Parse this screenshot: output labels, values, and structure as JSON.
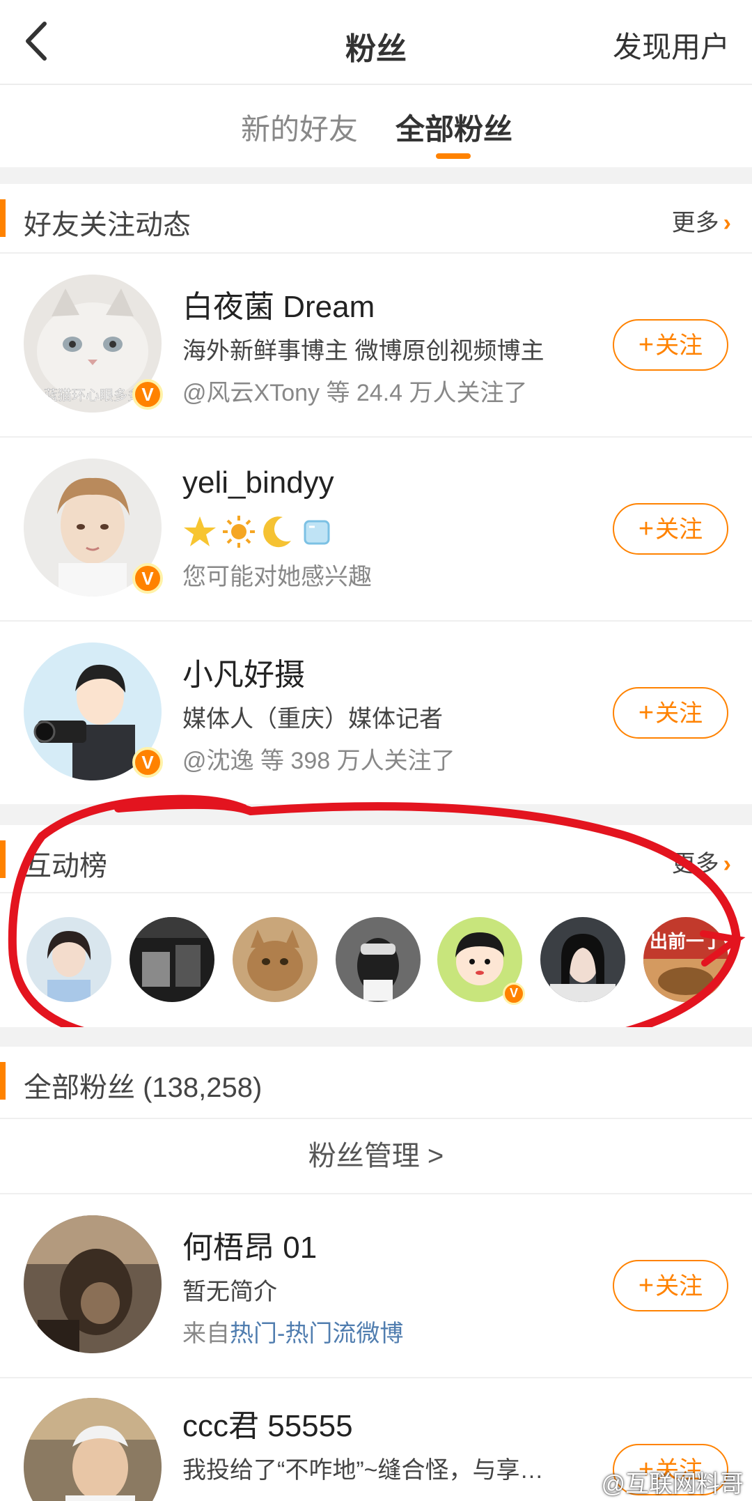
{
  "nav": {
    "title": "粉丝",
    "right_label": "发现用户"
  },
  "tabs": {
    "new_friends": "新的好友",
    "all_fans": "全部粉丝"
  },
  "friends_section": {
    "title": "好友关注动态",
    "more": "更多"
  },
  "friends": [
    {
      "name": "白夜菌 Dream",
      "desc": "海外新鲜事博主 微博原创视频博主",
      "sub": "@风云XTony 等 24.4 万人关注了",
      "avatar_text": "蓝猫环心眼多多",
      "verified": true,
      "follow": "关注"
    },
    {
      "name": "yeli_bindyy",
      "desc_emojis": [
        "star-emoji",
        "sun-emoji",
        "moon-emoji",
        "ice-emoji"
      ],
      "sub": "您可能对她感兴趣",
      "verified": true,
      "follow": "关注"
    },
    {
      "name": "小凡好摄",
      "desc": "媒体人（重庆）媒体记者",
      "sub": "@沈逸 等 398 万人关注了",
      "verified": true,
      "follow": "关注"
    }
  ],
  "interaction_section": {
    "title": "互动榜",
    "more": "更多",
    "last_avatar_text": "出前一丁"
  },
  "all_fans_section": {
    "title": "全部粉丝 (138,258)",
    "manage": "粉丝管理  >"
  },
  "fans": [
    {
      "name": "何梧昂 01",
      "desc": "暂无简介",
      "sub_prefix": "来自",
      "sub_link": "热门-热门流微博",
      "follow": "关注"
    },
    {
      "name": "ccc君 55555",
      "desc": "我投给了“不咋地”~缝合怪，与享…",
      "follow": "关注"
    }
  ],
  "watermark": "@互联网料哥",
  "colors": {
    "accent": "#ff8200",
    "annotation": "#e3141f",
    "link": "#507daf"
  }
}
